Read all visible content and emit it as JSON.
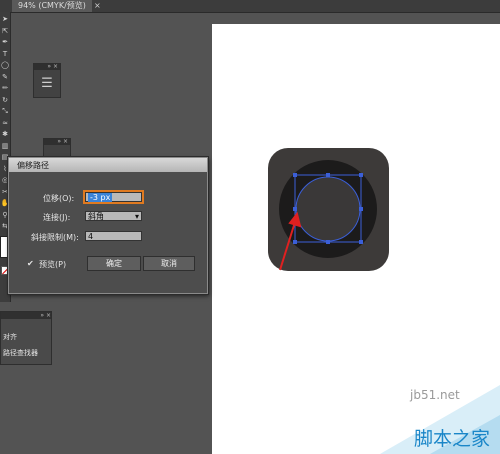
{
  "document_tab": {
    "title": "94% (CMYK/预览)",
    "close": "×"
  },
  "toolbar": {
    "tools": [
      {
        "icon": "selection-arrow-icon",
        "glyph": "➤"
      },
      {
        "icon": "direct-select-icon",
        "glyph": "⇱"
      },
      {
        "icon": "pen-icon",
        "glyph": "✒"
      },
      {
        "icon": "type-icon",
        "glyph": "T"
      },
      {
        "icon": "ellipse-icon",
        "glyph": "◯"
      },
      {
        "icon": "brush-icon",
        "glyph": "✎"
      },
      {
        "icon": "pencil-icon",
        "glyph": "✏"
      },
      {
        "icon": "rotate-icon",
        "glyph": "↻"
      },
      {
        "icon": "scale-icon",
        "glyph": "⤡"
      },
      {
        "icon": "warp-icon",
        "glyph": "≈"
      },
      {
        "icon": "symbol-sprayer-icon",
        "glyph": "✱"
      },
      {
        "icon": "graph-icon",
        "glyph": "▥"
      },
      {
        "icon": "gradient-icon",
        "glyph": "▤"
      },
      {
        "icon": "eyedropper-icon",
        "glyph": "⌇"
      },
      {
        "icon": "blend-icon",
        "glyph": "◎"
      },
      {
        "icon": "scissors-icon",
        "glyph": "✂"
      },
      {
        "icon": "hand-icon",
        "glyph": "✋"
      },
      {
        "icon": "zoom-icon",
        "glyph": "⚲"
      },
      {
        "icon": "swap-icon",
        "glyph": "⇆"
      }
    ]
  },
  "mini_panels": [
    {
      "head": "» ×",
      "icon": "panel-list-icon",
      "glyph": "☰"
    },
    {
      "head": "» ×",
      "icon": "panel-list-icon",
      "glyph": "☰"
    }
  ],
  "dialog": {
    "title": "偏移路径",
    "offset_label": "位移(O):",
    "offset_value": "-3 px",
    "join_label": "连接(J):",
    "join_value": "斜角",
    "miter_label": "斜接限制(M):",
    "miter_value": "4",
    "preview_label": "预览(P)",
    "preview_check": "✔",
    "ok_label": "确定",
    "cancel_label": "取消",
    "dropdown_glyph": "▾"
  },
  "bottom_panel": {
    "head": "» ×",
    "item1": "对齐",
    "item2": "路径查找器"
  },
  "colors": {
    "icon_outer": "#3d3a39",
    "icon_inner": "#1c1b1b",
    "icon_center": "#3a3838",
    "selection": "#3b5fd8",
    "arrow": "#e02020",
    "accent": "#3a83d8"
  },
  "watermark": {
    "site": "jb51.net",
    "brand": "脚本之家"
  }
}
